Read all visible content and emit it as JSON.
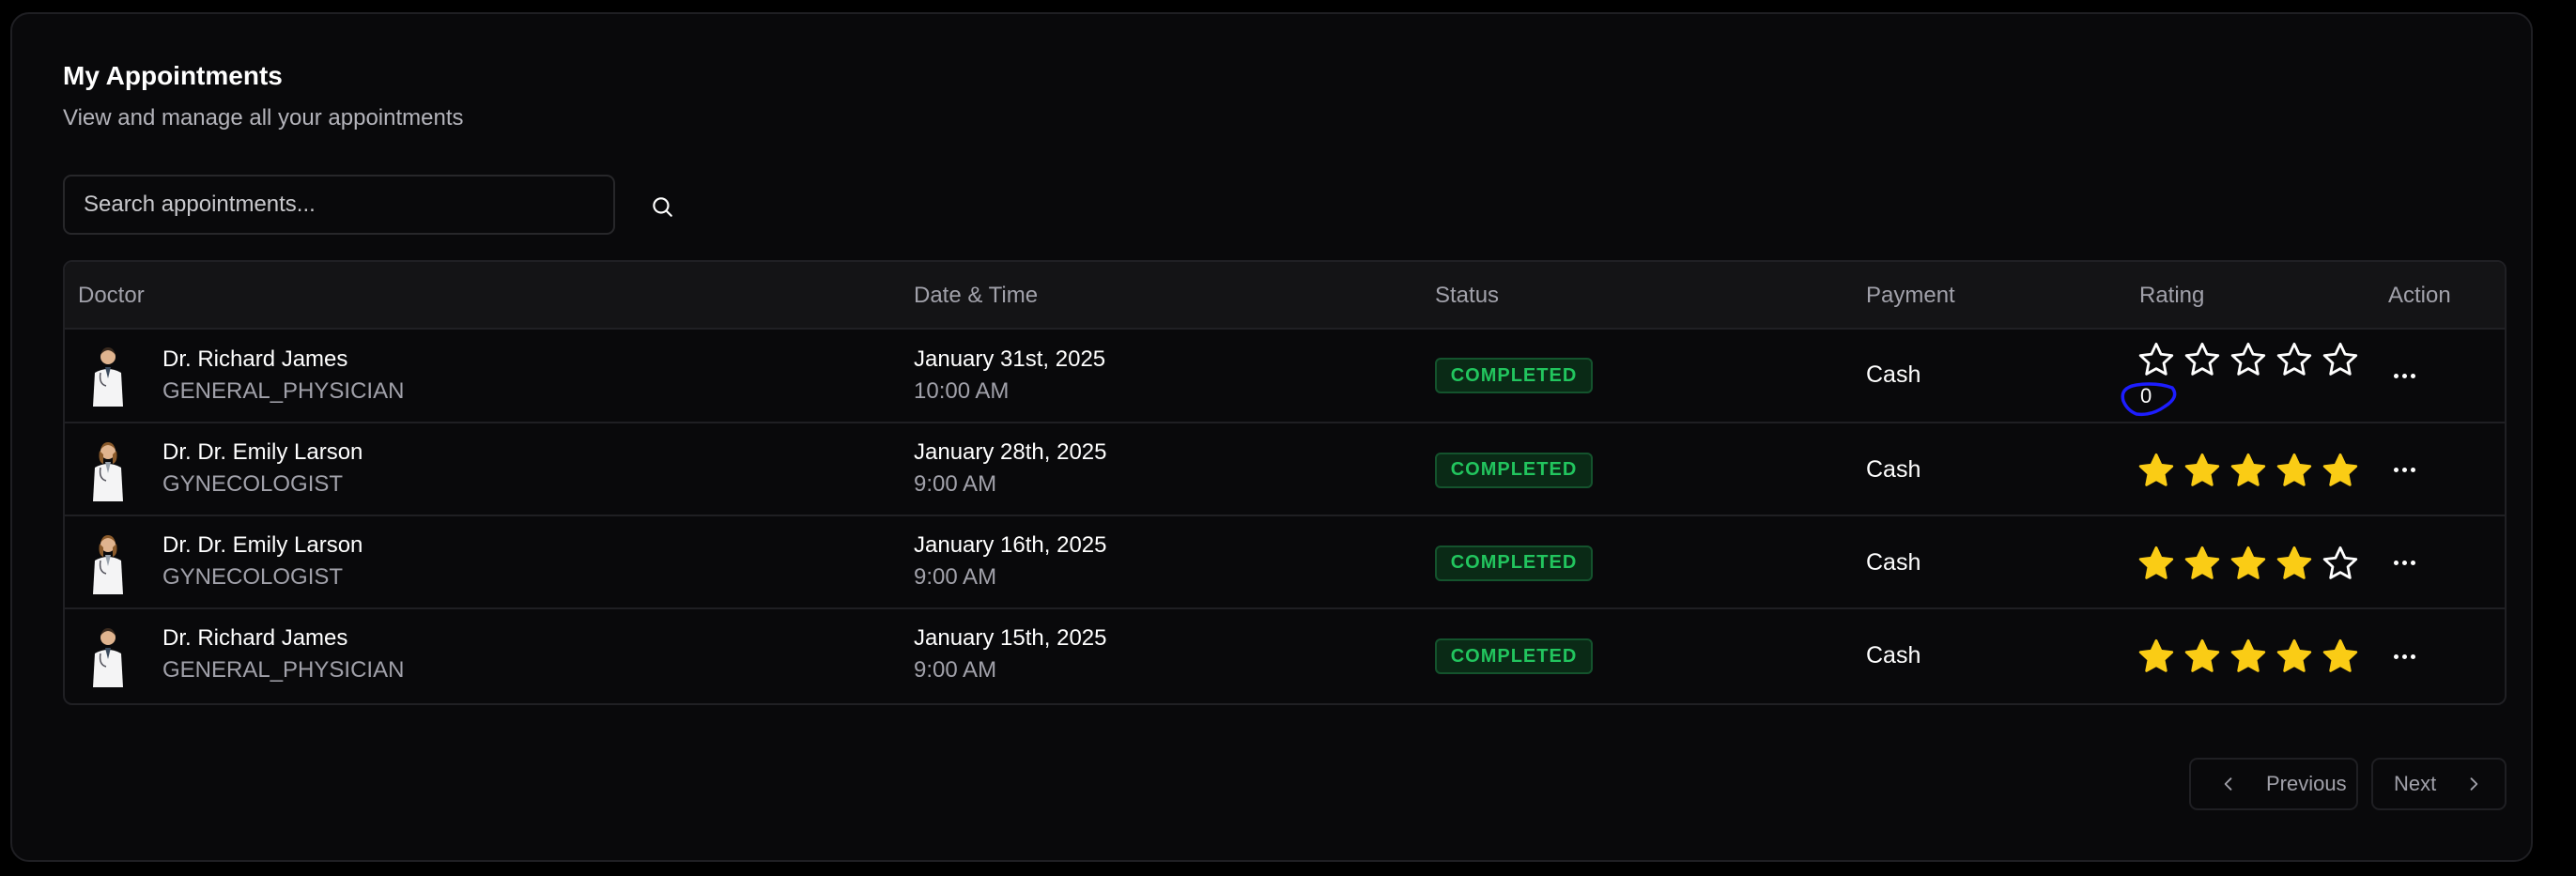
{
  "header": {
    "title": "My Appointments",
    "subtitle": "View and manage all your appointments"
  },
  "search": {
    "placeholder": "Search appointments...",
    "value": ""
  },
  "table": {
    "columns": [
      "Doctor",
      "Date & Time",
      "Status",
      "Payment",
      "Rating",
      "Action"
    ],
    "rows": [
      {
        "doctor_name": "Dr. Richard James",
        "speciality": "GENERAL_PHYSICIAN",
        "date": "January 31st, 2025",
        "time": "10:00 AM",
        "status": "COMPLETED",
        "payment": "Cash",
        "rating": 0,
        "rating_label": "0"
      },
      {
        "doctor_name": "Dr. Dr. Emily Larson",
        "speciality": "GYNECOLOGIST",
        "date": "January 28th, 2025",
        "time": "9:00 AM",
        "status": "COMPLETED",
        "payment": "Cash",
        "rating": 5
      },
      {
        "doctor_name": "Dr. Dr. Emily Larson",
        "speciality": "GYNECOLOGIST",
        "date": "January 16th, 2025",
        "time": "9:00 AM",
        "status": "COMPLETED",
        "payment": "Cash",
        "rating": 4
      },
      {
        "doctor_name": "Dr. Richard James",
        "speciality": "GENERAL_PHYSICIAN",
        "date": "January 15th, 2025",
        "time": "9:00 AM",
        "status": "COMPLETED",
        "payment": "Cash",
        "rating": 5
      }
    ]
  },
  "pagination": {
    "previous_label": "Previous",
    "next_label": "Next"
  },
  "icons": {
    "search": "search-icon",
    "star": "star-icon",
    "more": "more-horizontal-icon",
    "previous": "chevron-left-icon",
    "next": "chevron-right-icon",
    "avatar": "doctor-avatar"
  },
  "colors": {
    "background": "#09090b",
    "status_text": "#22c55e",
    "status_bg": "#0a2a16",
    "star_filled": "#facc15",
    "annotation": "#1d1dff"
  }
}
